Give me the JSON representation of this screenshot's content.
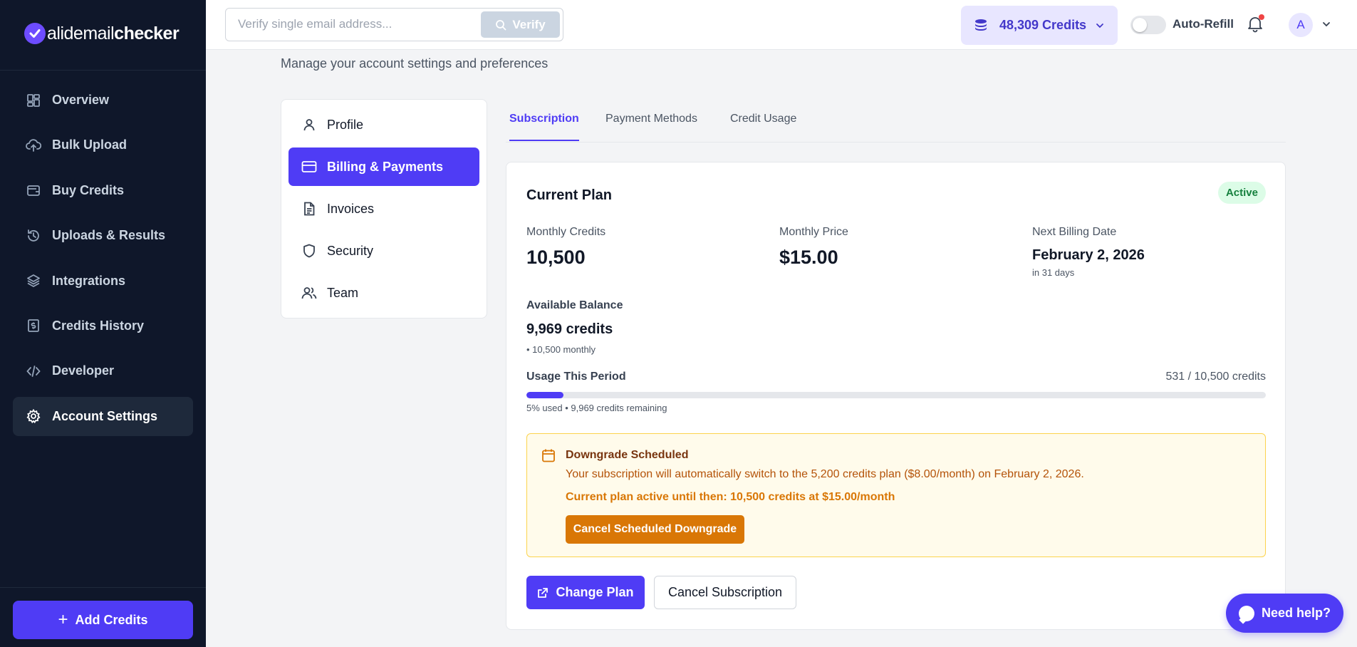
{
  "brand": {
    "logo_light": "alidemail",
    "logo_bold": "checker"
  },
  "sidebar": {
    "items": [
      {
        "label": "Overview",
        "icon": "grid-icon"
      },
      {
        "label": "Bulk Upload",
        "icon": "cloud-upload-icon"
      },
      {
        "label": "Buy Credits",
        "icon": "wallet-icon"
      },
      {
        "label": "Uploads & Results",
        "icon": "history-icon"
      },
      {
        "label": "Integrations",
        "icon": "layers-icon"
      },
      {
        "label": "Credits History",
        "icon": "receipt-icon"
      },
      {
        "label": "Developer",
        "icon": "code-icon"
      },
      {
        "label": "Account Settings",
        "icon": "gear-icon",
        "active": true
      }
    ],
    "add_credits_label": "Add Credits"
  },
  "topbar": {
    "search_placeholder": "Verify single email address...",
    "verify_label": "Verify",
    "credits_label": "48,309 Credits",
    "auto_refill_label": "Auto-Refill",
    "auto_refill_on": false,
    "avatar_initial": "A"
  },
  "page": {
    "subtitle": "Manage your account settings and preferences"
  },
  "settings_menu": [
    {
      "label": "Profile",
      "icon": "user-icon"
    },
    {
      "label": "Billing & Payments",
      "icon": "credit-card-icon",
      "active": true
    },
    {
      "label": "Invoices",
      "icon": "document-icon"
    },
    {
      "label": "Security",
      "icon": "shield-icon"
    },
    {
      "label": "Team",
      "icon": "users-icon"
    }
  ],
  "tabs": [
    {
      "label": "Subscription",
      "active": true
    },
    {
      "label": "Payment Methods"
    },
    {
      "label": "Credit Usage"
    }
  ],
  "plan": {
    "title": "Current Plan",
    "status": "Active",
    "monthly_credits_label": "Monthly Credits",
    "monthly_credits_value": "10,500",
    "monthly_price_label": "Monthly Price",
    "monthly_price_value": "$15.00",
    "next_billing_label": "Next Billing Date",
    "next_billing_value": "February 2, 2026",
    "next_billing_sub": "in 31 days",
    "balance_label": "Available Balance",
    "balance_value": "9,969 credits",
    "balance_sub": "• 10,500 monthly",
    "usage_label": "Usage This Period",
    "usage_count": "531 / 10,500 credits",
    "usage_fraction": 0.05,
    "usage_sub": "5% used • 9,969 credits remaining"
  },
  "alert": {
    "title": "Downgrade Scheduled",
    "text": "Your subscription will automatically switch to the 5,200 credits plan ($8.00/month) on February 2, 2026.",
    "strong": "Current plan active until then: 10,500 credits at $15.00/month",
    "button_label": "Cancel Scheduled Downgrade"
  },
  "actions": {
    "change_plan_label": "Change Plan",
    "cancel_subscription_label": "Cancel Subscription"
  },
  "help": {
    "label": "Need help?"
  },
  "colors": {
    "accent": "#4f3cf5",
    "sidebar_bg": "#0f172a",
    "warning": "#d97706",
    "success": "#15803d"
  }
}
